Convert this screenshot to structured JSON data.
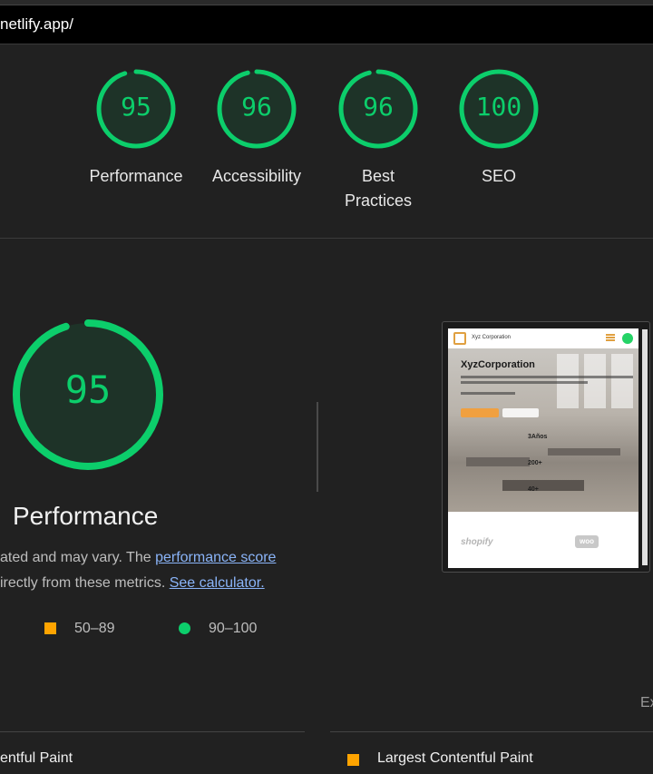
{
  "url": "netlify.app/",
  "colors": {
    "pass": "#0cce6b",
    "average": "#ffa400",
    "link": "#8ab4f8",
    "background": "#212121"
  },
  "categories": [
    {
      "score": "95",
      "label": "Performance"
    },
    {
      "score": "96",
      "label": "Accessibility"
    },
    {
      "score": "96",
      "label_line1": "Best",
      "label_line2": "Practices"
    },
    {
      "score": "100",
      "label": "SEO"
    }
  ],
  "performance": {
    "score": "95",
    "title": "Performance",
    "desc1_prefix": "ated and may vary. The ",
    "desc1_link": "performance score",
    "desc2_prefix": "irectly from these metrics. ",
    "desc2_link": "See calculator.",
    "legend": [
      {
        "icon": "orange-square-icon",
        "range": "50–89"
      },
      {
        "icon": "green-circle-icon",
        "range": "90–100"
      }
    ]
  },
  "screenshot": {
    "brand": "Xyz Corporation",
    "hero_title": "XyzCorporation",
    "stats": [
      "3Años",
      "200+",
      "40+"
    ],
    "logos": [
      "shopify",
      "woo"
    ]
  },
  "expand_fragment": "Ex",
  "metrics": [
    "entful Paint",
    "Largest Contentful Paint"
  ]
}
